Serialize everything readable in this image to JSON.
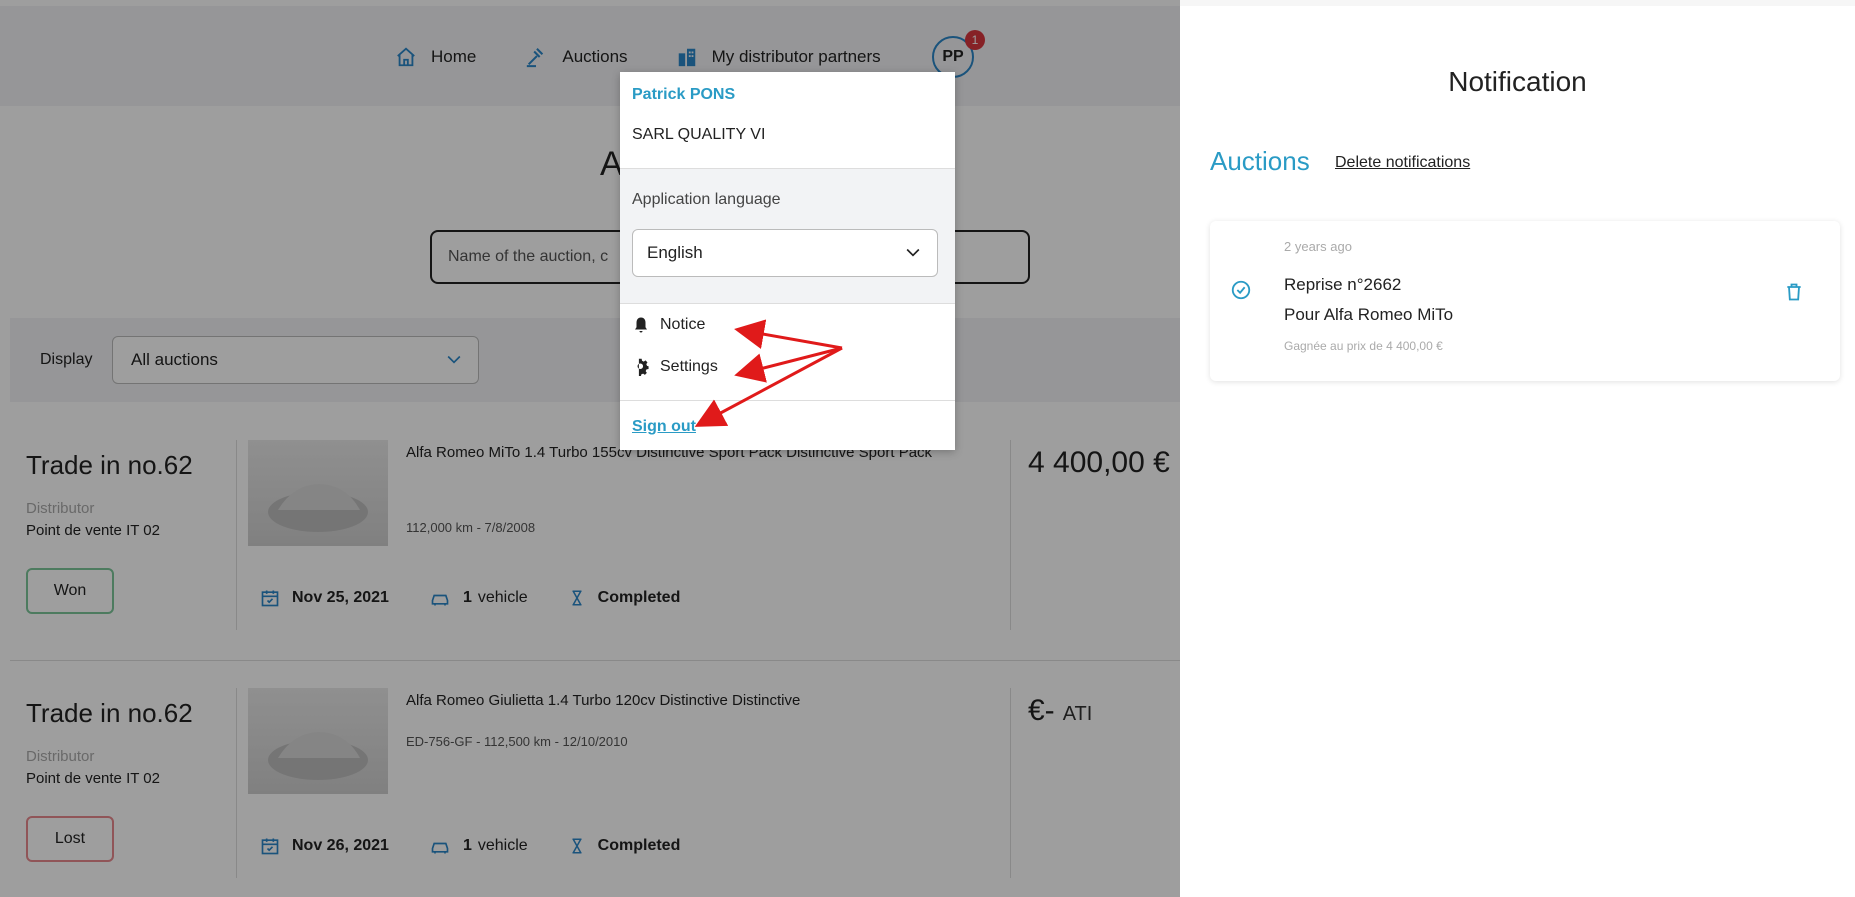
{
  "nav": {
    "home": "Home",
    "auctions": "Auctions",
    "partners": "My distributor partners",
    "avatar_initials": "PP",
    "avatar_badge": "1"
  },
  "main": {
    "title": "A",
    "search_placeholder": "Name of the auction, c",
    "filter_label": "Display",
    "filter_value": "All auctions"
  },
  "cards": [
    {
      "title": "Trade in no.62",
      "distributor_label": "Distributor",
      "distributor": "Point de vente IT 02",
      "status": "Won",
      "description": "Alfa Romeo MiTo 1.4 Turbo 155cv Distinctive Sport Pack Distinctive Sport Pack",
      "details": "112,000 km - 7/8/2008",
      "date": "Nov 25, 2021",
      "vehicle_count": "1",
      "vehicle_label": "vehicle",
      "state": "Completed",
      "price": "4 400,00 €",
      "price_suffix": ""
    },
    {
      "title": "Trade in no.62",
      "distributor_label": "Distributor",
      "distributor": "Point de vente IT 02",
      "status": "Lost",
      "description": "Alfa Romeo Giulietta 1.4 Turbo 120cv Distinctive Distinctive",
      "details": "ED-756-GF - 112,500 km - 12/10/2010",
      "date": "Nov 26, 2021",
      "vehicle_count": "1",
      "vehicle_label": "vehicle",
      "state": "Completed",
      "price": "€-",
      "price_suffix": "ATI"
    }
  ],
  "dropdown": {
    "user_name": "Patrick PONS",
    "company": "SARL QUALITY VI",
    "language_label": "Application language",
    "language_value": "English",
    "notice": "Notice",
    "settings": "Settings",
    "sign_out": "Sign out"
  },
  "notification_panel": {
    "title": "Notification",
    "section": "Auctions",
    "delete_link": "Delete notifications",
    "items": [
      {
        "time": "2 years ago",
        "title": "Reprise n°2662",
        "subtitle": "Pour Alfa Romeo MiTo",
        "detail": "Gagnée au prix de 4 400,00 €"
      }
    ]
  },
  "colors": {
    "accent": "#2a9bc5",
    "won_border": "#7cc79a",
    "lost_border": "#e98a8f",
    "badge": "#d9363e",
    "annotation_arrow": "#e01a1a"
  }
}
